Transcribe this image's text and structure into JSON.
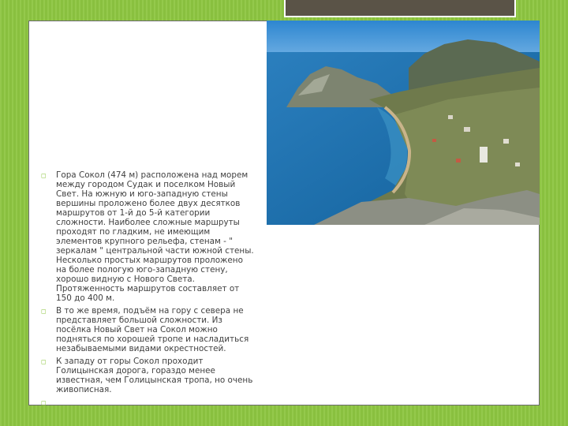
{
  "slide": {
    "bullet_glyph": "◻",
    "paragraphs": [
      "Гора Сокол (474 м) расположена над морем между городом Судак и поселком Новый Свет. На южную и юго-западную стены вершины проложено более двух десятков маршрутов от 1-й до 5-й категории сложности. Наиболее сложные маршруты проходят по гладким, не имеющим элементов крупного рельефа, стенам - \" зеркалам \" центральной части южной стены. Несколько простых маршрутов проложено на более пологую юго-западную стену, хорошо видную с Нового Света. Протяженность маршрутов составляет от 150 до 400 м.",
      "В то же время, подъём на гору с севера не представляет большой сложности. Из посёлка Новый Свет на Сокол можно подняться по хорошей тропе и насладиться незабываемыми видами окрестностей.",
      "К западу от горы Сокол проходит Голицынская дорога, гораздо менее известная, чем Голицынская тропа, но очень живописная.",
      ""
    ]
  },
  "colors": {
    "background": "#8dc641",
    "title_tab": "#5a5347",
    "text": "#404040",
    "sea": "#1f78b0",
    "sky": "#3b95d8"
  },
  "photo": {
    "subject": "coastal-mountain-photo"
  }
}
